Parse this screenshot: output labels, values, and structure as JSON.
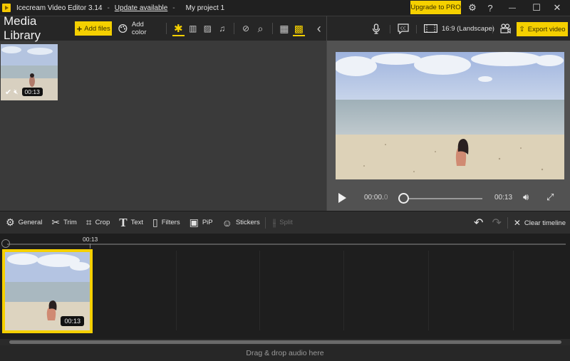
{
  "titlebar": {
    "app_name": "Icecream Video Editor 3.14",
    "separator": "-",
    "update_link": "Update available",
    "project_name": "My project 1",
    "upgrade_label": "Upgrade to PRO",
    "icons": {
      "settings": "⚙",
      "help": "?",
      "minimize": "—",
      "maximize": "☐",
      "close": "✕"
    }
  },
  "media_library": {
    "title": "Media Library",
    "add_files_label": "Add files",
    "add_files_icon": "+",
    "add_color_label": "Add color",
    "filter_icons": [
      {
        "name": "all-media-icon",
        "glyph": "✱",
        "active": true
      },
      {
        "name": "video-filter-icon",
        "glyph": "▥",
        "active": false
      },
      {
        "name": "image-filter-icon",
        "glyph": "▨",
        "active": false
      },
      {
        "name": "audio-filter-icon",
        "glyph": "♫",
        "active": false
      }
    ],
    "unused-filter-glyph": "⊘",
    "search_glyph": "⌕",
    "view_large_glyph": "▦",
    "view_small_glyph": "▩",
    "collapse_glyph": "‹",
    "items": [
      {
        "duration": "00:13",
        "used": true,
        "muted": true
      }
    ]
  },
  "preview": {
    "aspect_label": "16:9 (Landscape)",
    "export_label": "Export video",
    "current_time_main": "00:00.",
    "current_time_frac": "0",
    "total_time": "00:13",
    "progress": 0
  },
  "edit_toolbar": {
    "tools": [
      {
        "label": "General",
        "glyph": "⚙",
        "enabled": true
      },
      {
        "label": "Trim",
        "glyph": "✂",
        "enabled": true
      },
      {
        "label": "Crop",
        "glyph": "⌗",
        "enabled": true
      },
      {
        "label": "Text",
        "glyph": "T",
        "enabled": true
      },
      {
        "label": "Filters",
        "glyph": "▯",
        "enabled": true
      },
      {
        "label": "PiP",
        "glyph": "▣",
        "enabled": true
      },
      {
        "label": "Stickers",
        "glyph": "☺",
        "enabled": true
      },
      {
        "label": "Split",
        "glyph": "⫲",
        "enabled": false
      }
    ],
    "undo_glyph": "↶",
    "redo_glyph": "↷",
    "clear_label": "Clear timeline",
    "clear_glyph": "✕"
  },
  "timeline": {
    "ruler_label": "00:13",
    "clips": [
      {
        "duration": "00:13",
        "selected": true
      }
    ]
  },
  "audio_track": {
    "placeholder": "Drag & drop audio here"
  },
  "colors": {
    "accent": "#f5d000",
    "background": "#202020",
    "panel": "#3a3a3a"
  }
}
